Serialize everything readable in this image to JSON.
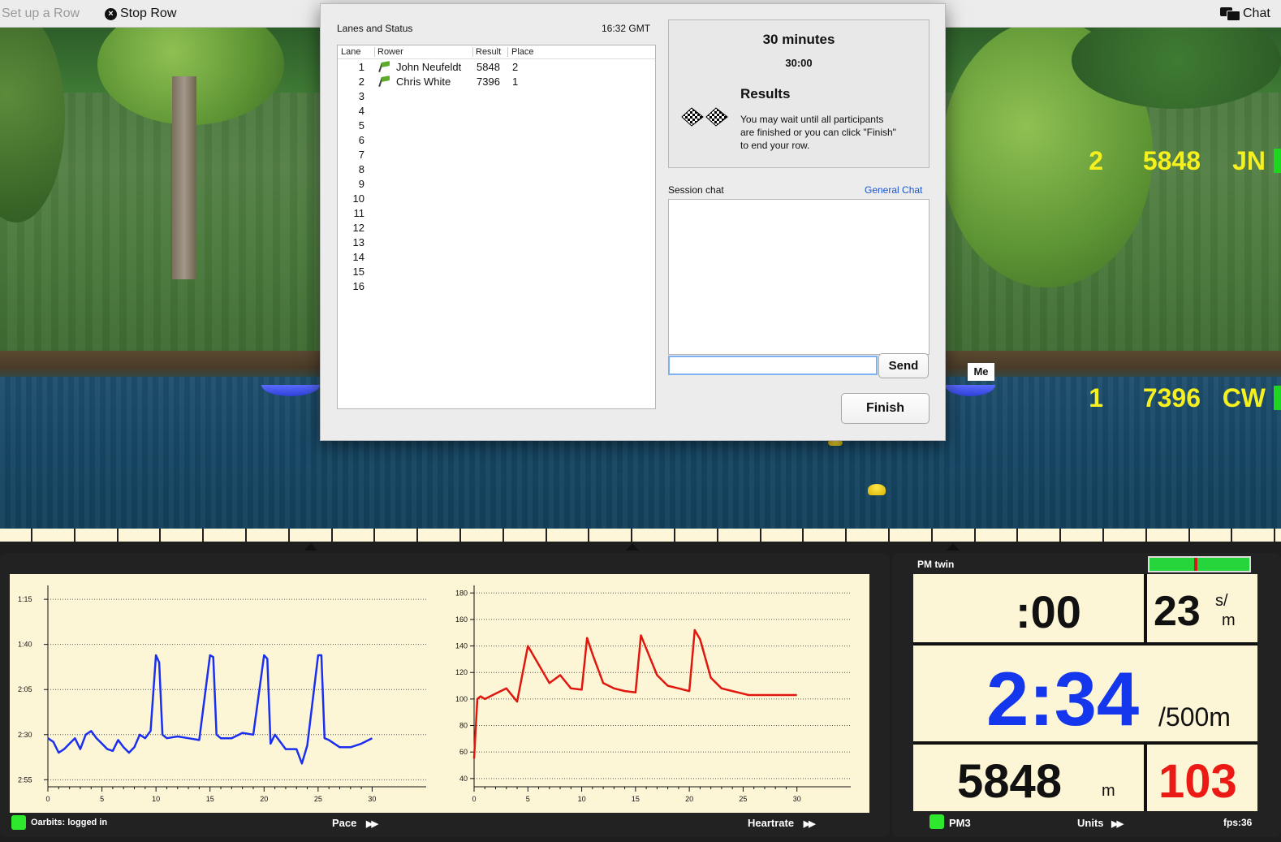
{
  "toolbar": {
    "setup_label": "Set up a Row",
    "stop_label": "Stop Row",
    "chat_label": "Chat"
  },
  "scene": {
    "me_label": "Me",
    "scoreboard": [
      {
        "place": "2",
        "distance": "5848",
        "initials": "JN"
      },
      {
        "place": "1",
        "distance": "7396",
        "initials": "CW"
      }
    ]
  },
  "dialog": {
    "lanes_title": "Lanes and Status",
    "time": "16:32 GMT",
    "columns": {
      "lane": "Lane",
      "rower": "Rower",
      "result": "Result",
      "place": "Place"
    },
    "lanes": [
      {
        "lane": "1",
        "rower": "John Neufeldt",
        "result": "5848",
        "place": "2"
      },
      {
        "lane": "2",
        "rower": "Chris White",
        "result": "7396",
        "place": "1"
      },
      {
        "lane": "3",
        "rower": "",
        "result": "",
        "place": ""
      },
      {
        "lane": "4",
        "rower": "",
        "result": "",
        "place": ""
      },
      {
        "lane": "5",
        "rower": "",
        "result": "",
        "place": ""
      },
      {
        "lane": "6",
        "rower": "",
        "result": "",
        "place": ""
      },
      {
        "lane": "7",
        "rower": "",
        "result": "",
        "place": ""
      },
      {
        "lane": "8",
        "rower": "",
        "result": "",
        "place": ""
      },
      {
        "lane": "9",
        "rower": "",
        "result": "",
        "place": ""
      },
      {
        "lane": "10",
        "rower": "",
        "result": "",
        "place": ""
      },
      {
        "lane": "11",
        "rower": "",
        "result": "",
        "place": ""
      },
      {
        "lane": "12",
        "rower": "",
        "result": "",
        "place": ""
      },
      {
        "lane": "13",
        "rower": "",
        "result": "",
        "place": ""
      },
      {
        "lane": "14",
        "rower": "",
        "result": "",
        "place": ""
      },
      {
        "lane": "15",
        "rower": "",
        "result": "",
        "place": ""
      },
      {
        "lane": "16",
        "rower": "",
        "result": "",
        "place": ""
      }
    ],
    "workout_title": "30 minutes",
    "workout_time": "30:00",
    "results_heading": "Results",
    "results_text_1": "You may wait until all participants",
    "results_text_2": "are finished or you can click \"Finish\"",
    "results_text_3": "to end your row.",
    "session_chat_label": "Session chat",
    "general_chat_link": "General Chat",
    "chat_input_value": "",
    "send_label": "Send",
    "finish_label": "Finish"
  },
  "graphs": {
    "login_status": "Oarbits: logged in",
    "pace_label": "Pace",
    "heartrate_label": "Heartrate"
  },
  "chart_data": [
    {
      "type": "line",
      "color": "#1a2ff0",
      "yticks": [
        "1:15",
        "1:40",
        "2:05",
        "2:30",
        "2:55"
      ],
      "yvalues_seconds": [
        75,
        100,
        125,
        150,
        175
      ],
      "ylim_seconds": [
        70,
        178
      ],
      "y_inverted": true,
      "xticks": [
        "0",
        "5",
        "10",
        "15",
        "20",
        "25",
        "30"
      ],
      "xlim": [
        0,
        35
      ],
      "series": [
        {
          "x": [
            0,
            0.5,
            1,
            1.5,
            2,
            2.5,
            3,
            3.5,
            4,
            4.5,
            5,
            5.5,
            6,
            6.5,
            7,
            7.5,
            8,
            8.5,
            9,
            9.5,
            10,
            10.3,
            10.6,
            11,
            12,
            13,
            14,
            15,
            15.3,
            15.6,
            16,
            17,
            18,
            19,
            20,
            20.3,
            20.6,
            21,
            22,
            23,
            23.5,
            24,
            25,
            25.3,
            25.6,
            26,
            27,
            28,
            29,
            30
          ],
          "y": [
            152,
            154,
            160,
            158,
            155,
            152,
            158,
            150,
            148,
            152,
            155,
            158,
            159,
            153,
            157,
            160,
            157,
            150,
            152,
            148,
            106,
            110,
            150,
            152,
            151,
            152,
            153,
            106,
            107,
            150,
            152,
            152,
            149,
            150,
            106,
            108,
            155,
            150,
            158,
            158,
            166,
            156,
            106,
            106,
            152,
            153,
            157,
            157,
            155,
            152
          ]
        }
      ]
    },
    {
      "type": "line",
      "color": "#e0170f",
      "yticks": [
        "180",
        "160",
        "140",
        "120",
        "100",
        "80",
        "60",
        "40"
      ],
      "ylim": [
        35,
        182
      ],
      "xticks": [
        "0",
        "5",
        "10",
        "15",
        "20",
        "25",
        "30"
      ],
      "xlim": [
        0,
        35
      ],
      "series": [
        {
          "x": [
            0,
            0.3,
            0.6,
            1,
            2,
            3,
            4,
            5,
            6,
            7,
            8,
            9,
            10,
            10.5,
            11,
            12,
            13,
            14,
            15,
            15.5,
            16,
            17,
            18,
            19,
            20,
            20.5,
            21,
            22,
            23,
            24,
            25,
            25.5,
            26,
            27,
            28,
            29,
            30
          ],
          "y": [
            55,
            100,
            102,
            100,
            104,
            108,
            98,
            140,
            126,
            112,
            118,
            108,
            107,
            146,
            134,
            112,
            108,
            106,
            105,
            148,
            138,
            118,
            110,
            108,
            106,
            152,
            145,
            116,
            108,
            106,
            104,
            103,
            103,
            103,
            103,
            103,
            103
          ]
        }
      ]
    }
  ],
  "pm": {
    "title": "PM twin",
    "time": ":00",
    "spm": "23",
    "spm_unit_top": "s/",
    "spm_unit_bottom": "m",
    "pace": "2:34",
    "pace_unit": "/500m",
    "distance": "5848",
    "distance_unit": "m",
    "heart_rate": "103",
    "gauge_level": 0.45,
    "monitor_label": "PM3",
    "units_label": "Units",
    "fps": "fps:36"
  }
}
